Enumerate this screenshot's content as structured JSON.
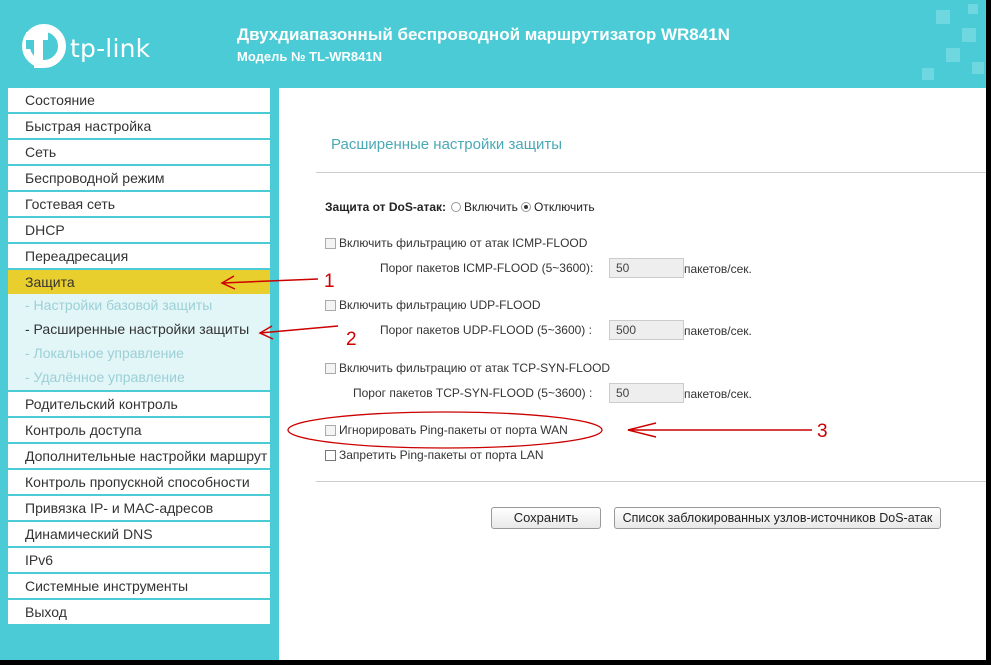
{
  "header": {
    "logo_text": "tp-link",
    "title": "Двухдиапазонный беспроводной маршрутизатор WR841N",
    "model": "Модель № TL-WR841N",
    "color": "#4acbd6"
  },
  "sidebar": {
    "items_top": [
      {
        "label": "Состояние"
      },
      {
        "label": "Быстрая настройка"
      },
      {
        "label": "Сеть"
      },
      {
        "label": "Беспроводной режим"
      },
      {
        "label": "Гостевая сеть"
      },
      {
        "label": "DHCP"
      },
      {
        "label": "Переадресация"
      },
      {
        "label": "Защита"
      }
    ],
    "submenu": [
      {
        "label": "- Настройки базовой защиты"
      },
      {
        "label": "- Расширенные настройки защиты"
      },
      {
        "label": "- Локальное управление"
      },
      {
        "label": "- Удалённое управление"
      }
    ],
    "items_bottom": [
      {
        "label": "Родительский контроль"
      },
      {
        "label": "Контроль доступа"
      },
      {
        "label": "Дополнительные настройки маршрут"
      },
      {
        "label": "Контроль пропускной способности"
      },
      {
        "label": "Привязка IP- и MAC-адресов"
      },
      {
        "label": "Динамический DNS"
      },
      {
        "label": "IPv6"
      },
      {
        "label": "Системные инструменты"
      },
      {
        "label": "Выход"
      }
    ],
    "active_color": "#e8cf2d"
  },
  "main": {
    "title": "Расширенные настройки защиты",
    "dos": {
      "label": "Защита от DoS-атак:",
      "enable_label": "Включить",
      "disable_label": "Отключить",
      "selected": "Отключить"
    },
    "icmp": {
      "checkbox_label": "Включить фильтрацию от атак ICMP-FLOOD",
      "threshold_label": "Порог пакетов ICMP-FLOOD (5~3600):",
      "value": "50",
      "unit": "пакетов/сек."
    },
    "udp": {
      "checkbox_label": "Включить фильтрацию UDP-FLOOD",
      "threshold_label": "Порог пакетов UDP-FLOOD (5~3600) :",
      "value": "500",
      "unit": "пакетов/сек."
    },
    "tcp": {
      "checkbox_label": "Включить фильтрацию от атак TCP-SYN-FLOOD",
      "threshold_label": "Порог пакетов TCP-SYN-FLOOD (5~3600) :",
      "value": "50",
      "unit": "пакетов/сек."
    },
    "ping_wan_label": "Игнорировать Ping-пакеты от порта WAN",
    "ping_lan_label": "Запретить Ping-пакеты от порта LAN",
    "save_label": "Сохранить",
    "blocked_list_label": "Список заблокированных узлов-источников DoS-атак"
  },
  "annotations": {
    "labels": [
      "1",
      "2",
      "3"
    ],
    "color": "#cc0000"
  }
}
